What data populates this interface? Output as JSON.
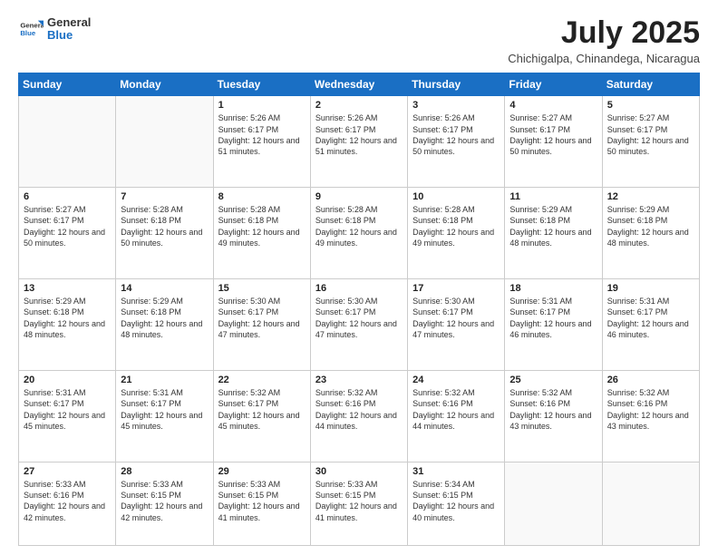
{
  "header": {
    "logo_line1": "General",
    "logo_line2": "Blue",
    "title": "July 2025",
    "location": "Chichigalpa, Chinandega, Nicaragua"
  },
  "days_of_week": [
    "Sunday",
    "Monday",
    "Tuesday",
    "Wednesday",
    "Thursday",
    "Friday",
    "Saturday"
  ],
  "weeks": [
    [
      {
        "day": "",
        "info": ""
      },
      {
        "day": "",
        "info": ""
      },
      {
        "day": "1",
        "info": "Sunrise: 5:26 AM\nSunset: 6:17 PM\nDaylight: 12 hours and 51 minutes."
      },
      {
        "day": "2",
        "info": "Sunrise: 5:26 AM\nSunset: 6:17 PM\nDaylight: 12 hours and 51 minutes."
      },
      {
        "day": "3",
        "info": "Sunrise: 5:26 AM\nSunset: 6:17 PM\nDaylight: 12 hours and 50 minutes."
      },
      {
        "day": "4",
        "info": "Sunrise: 5:27 AM\nSunset: 6:17 PM\nDaylight: 12 hours and 50 minutes."
      },
      {
        "day": "5",
        "info": "Sunrise: 5:27 AM\nSunset: 6:17 PM\nDaylight: 12 hours and 50 minutes."
      }
    ],
    [
      {
        "day": "6",
        "info": "Sunrise: 5:27 AM\nSunset: 6:17 PM\nDaylight: 12 hours and 50 minutes."
      },
      {
        "day": "7",
        "info": "Sunrise: 5:28 AM\nSunset: 6:18 PM\nDaylight: 12 hours and 50 minutes."
      },
      {
        "day": "8",
        "info": "Sunrise: 5:28 AM\nSunset: 6:18 PM\nDaylight: 12 hours and 49 minutes."
      },
      {
        "day": "9",
        "info": "Sunrise: 5:28 AM\nSunset: 6:18 PM\nDaylight: 12 hours and 49 minutes."
      },
      {
        "day": "10",
        "info": "Sunrise: 5:28 AM\nSunset: 6:18 PM\nDaylight: 12 hours and 49 minutes."
      },
      {
        "day": "11",
        "info": "Sunrise: 5:29 AM\nSunset: 6:18 PM\nDaylight: 12 hours and 48 minutes."
      },
      {
        "day": "12",
        "info": "Sunrise: 5:29 AM\nSunset: 6:18 PM\nDaylight: 12 hours and 48 minutes."
      }
    ],
    [
      {
        "day": "13",
        "info": "Sunrise: 5:29 AM\nSunset: 6:18 PM\nDaylight: 12 hours and 48 minutes."
      },
      {
        "day": "14",
        "info": "Sunrise: 5:29 AM\nSunset: 6:18 PM\nDaylight: 12 hours and 48 minutes."
      },
      {
        "day": "15",
        "info": "Sunrise: 5:30 AM\nSunset: 6:17 PM\nDaylight: 12 hours and 47 minutes."
      },
      {
        "day": "16",
        "info": "Sunrise: 5:30 AM\nSunset: 6:17 PM\nDaylight: 12 hours and 47 minutes."
      },
      {
        "day": "17",
        "info": "Sunrise: 5:30 AM\nSunset: 6:17 PM\nDaylight: 12 hours and 47 minutes."
      },
      {
        "day": "18",
        "info": "Sunrise: 5:31 AM\nSunset: 6:17 PM\nDaylight: 12 hours and 46 minutes."
      },
      {
        "day": "19",
        "info": "Sunrise: 5:31 AM\nSunset: 6:17 PM\nDaylight: 12 hours and 46 minutes."
      }
    ],
    [
      {
        "day": "20",
        "info": "Sunrise: 5:31 AM\nSunset: 6:17 PM\nDaylight: 12 hours and 45 minutes."
      },
      {
        "day": "21",
        "info": "Sunrise: 5:31 AM\nSunset: 6:17 PM\nDaylight: 12 hours and 45 minutes."
      },
      {
        "day": "22",
        "info": "Sunrise: 5:32 AM\nSunset: 6:17 PM\nDaylight: 12 hours and 45 minutes."
      },
      {
        "day": "23",
        "info": "Sunrise: 5:32 AM\nSunset: 6:16 PM\nDaylight: 12 hours and 44 minutes."
      },
      {
        "day": "24",
        "info": "Sunrise: 5:32 AM\nSunset: 6:16 PM\nDaylight: 12 hours and 44 minutes."
      },
      {
        "day": "25",
        "info": "Sunrise: 5:32 AM\nSunset: 6:16 PM\nDaylight: 12 hours and 43 minutes."
      },
      {
        "day": "26",
        "info": "Sunrise: 5:32 AM\nSunset: 6:16 PM\nDaylight: 12 hours and 43 minutes."
      }
    ],
    [
      {
        "day": "27",
        "info": "Sunrise: 5:33 AM\nSunset: 6:16 PM\nDaylight: 12 hours and 42 minutes."
      },
      {
        "day": "28",
        "info": "Sunrise: 5:33 AM\nSunset: 6:15 PM\nDaylight: 12 hours and 42 minutes."
      },
      {
        "day": "29",
        "info": "Sunrise: 5:33 AM\nSunset: 6:15 PM\nDaylight: 12 hours and 41 minutes."
      },
      {
        "day": "30",
        "info": "Sunrise: 5:33 AM\nSunset: 6:15 PM\nDaylight: 12 hours and 41 minutes."
      },
      {
        "day": "31",
        "info": "Sunrise: 5:34 AM\nSunset: 6:15 PM\nDaylight: 12 hours and 40 minutes."
      },
      {
        "day": "",
        "info": ""
      },
      {
        "day": "",
        "info": ""
      }
    ]
  ]
}
